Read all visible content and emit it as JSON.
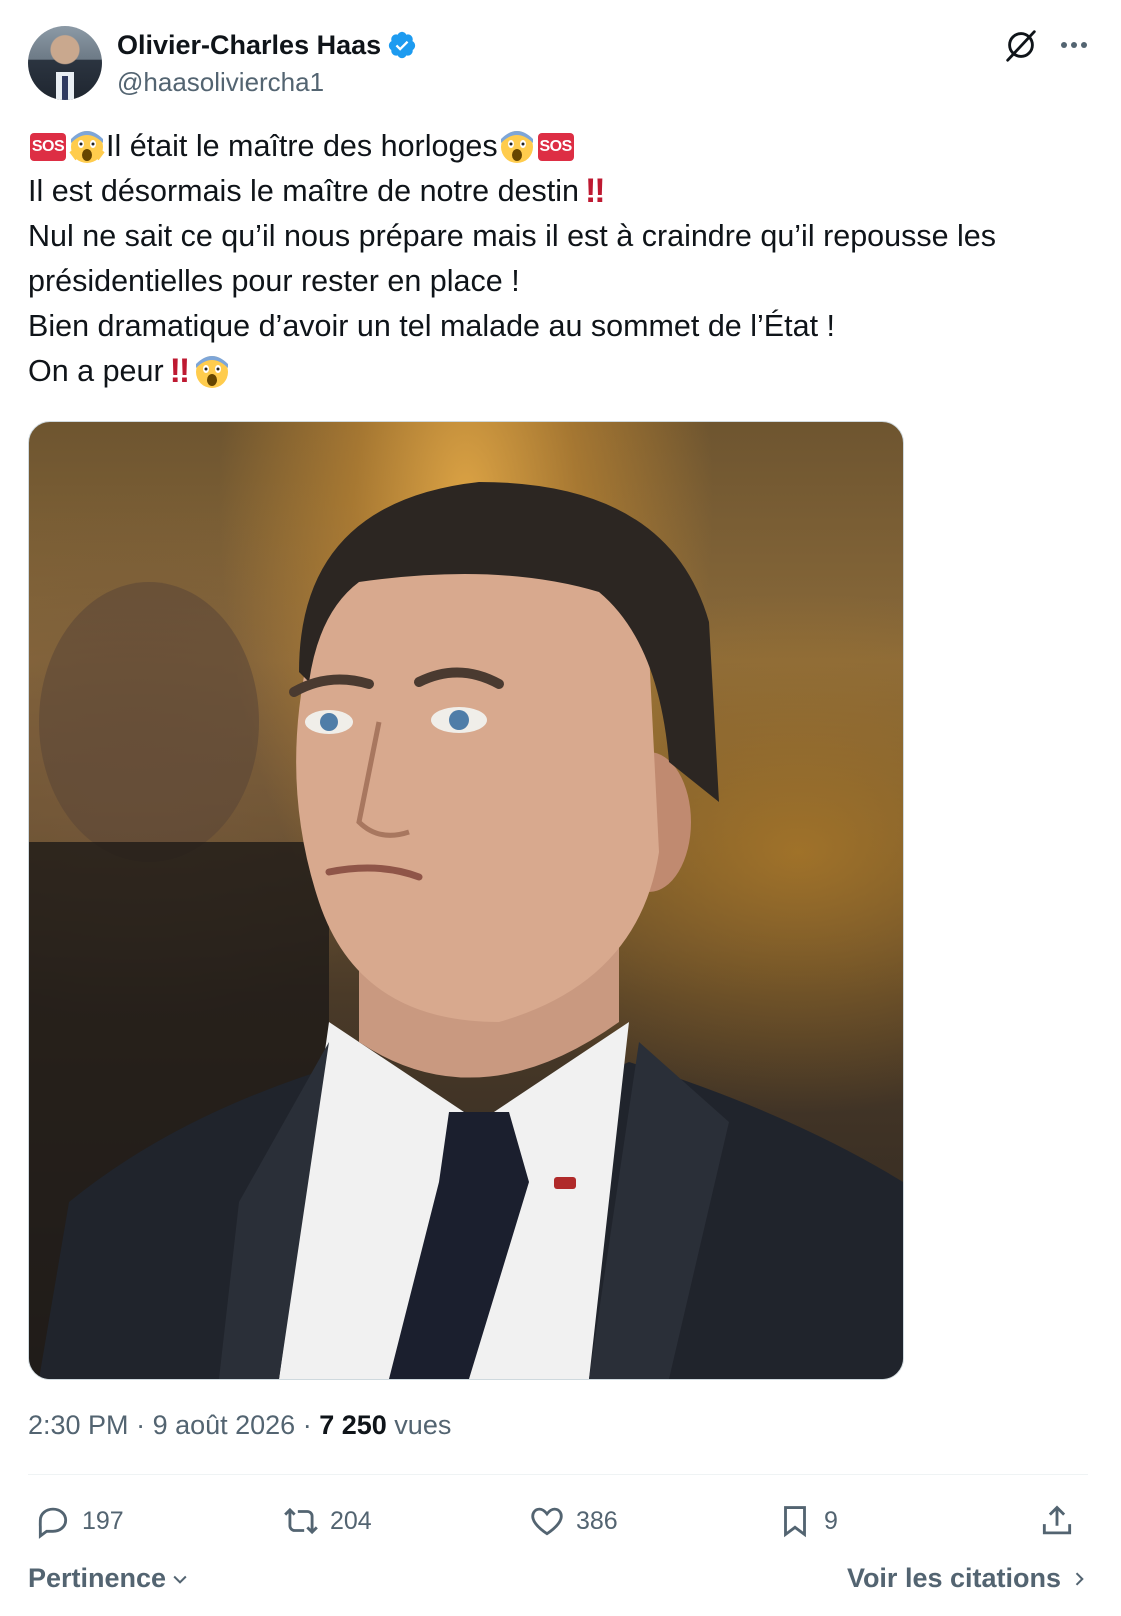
{
  "author": {
    "name": "Olivier-Charles Haas",
    "handle": "@haasoliviercha1",
    "verified": true
  },
  "tweet": {
    "line1_text_a": "Il était le maître  des horloges",
    "line2_text": "Il est désormais le maître de notre destin",
    "line3_text": "Nul ne sait ce qu’il nous prépare mais il est à craindre qu’il repousse les",
    "line4_text": "présidentielles pour rester en place !",
    "line5_text": "Bien dramatique d’avoir un tel malade au sommet de l’État !",
    "line6_text": "On a peur",
    "sos_label": "SOS",
    "double_bang": "‼"
  },
  "meta": {
    "time": "2:30 PM",
    "date": "9 août 2026",
    "separator": " · ",
    "views_count": "7 250",
    "views_label": "vues"
  },
  "actions": {
    "replies": "197",
    "reposts": "204",
    "likes": "386",
    "bookmarks": "9"
  },
  "footer": {
    "sort_label": "Pertinence",
    "quotes_label": "Voir les citations"
  },
  "colors": {
    "text": "#0f1419",
    "secondary": "#536471",
    "verified": "#1d9bf0",
    "sos": "#dd2e44",
    "bang": "#be1931"
  },
  "icons": [
    "verified-badge-icon",
    "grok-icon",
    "more-icon",
    "reply-icon",
    "repost-icon",
    "like-icon",
    "bookmark-icon",
    "share-icon",
    "chevron-down-icon",
    "chevron-right-icon"
  ]
}
